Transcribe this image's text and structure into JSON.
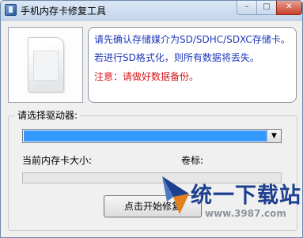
{
  "window": {
    "title": "手机内存卡修复工具"
  },
  "titlebar": {
    "minimize_icon": "minimize-icon",
    "maximize_icon": "maximize-icon",
    "close_icon": "close-icon"
  },
  "card_image": {
    "icon": "sd-card-icon"
  },
  "info": {
    "line1": "请先确认存储媒介为SD/SDHC/SDXC存储卡。",
    "line2": "若进行SD格式化，则所有数据将丢失。",
    "line3": "注意：请做好数据备份。",
    "normal_color": "#1f37b8",
    "warning_color": "#d4191c"
  },
  "drive": {
    "group_label": "请选择驱动器:",
    "selected_value": "",
    "dropdown_icon": "chevron-down-icon"
  },
  "card_size": {
    "label": "当前内存卡大小:"
  },
  "volume": {
    "label": "卷标:"
  },
  "progress": {
    "value": 0
  },
  "actions": {
    "start_label": "点击开始修复"
  },
  "watermark": {
    "title": "统一下载站",
    "url": "www.3987.com",
    "logo_icon": "compass-logo-icon"
  }
}
